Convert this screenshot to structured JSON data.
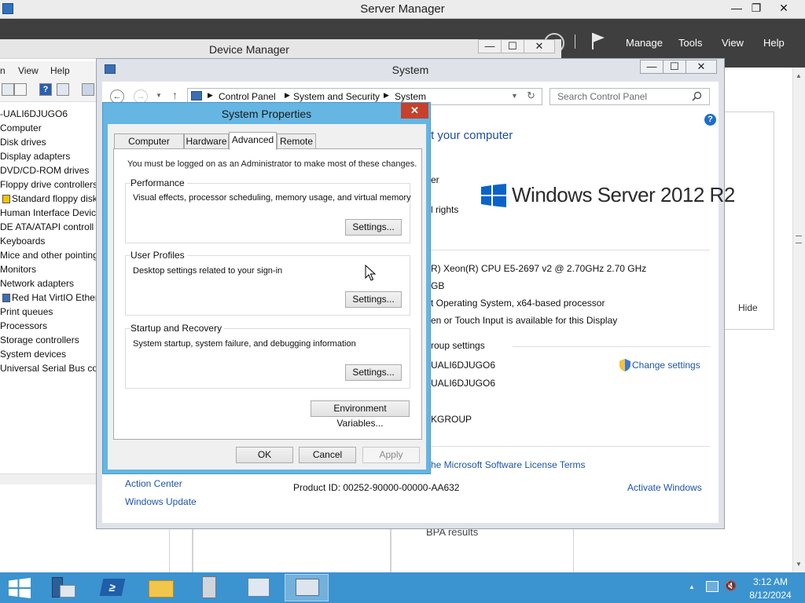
{
  "server_manager": {
    "title": "Server Manager",
    "menu": [
      "Manage",
      "Tools",
      "View",
      "Help"
    ],
    "controls": [
      "—",
      "❐",
      "✕"
    ],
    "hide_label": "Hide",
    "bpa_label": "BPA results"
  },
  "device_manager": {
    "title": "Device Manager",
    "controls": [
      "—",
      "☐",
      "✕"
    ],
    "menu": [
      "n",
      "View",
      "Help"
    ],
    "tree": [
      "-UALI6DJUGO6",
      "Computer",
      "Disk drives",
      "Display adapters",
      "DVD/CD-ROM drives",
      "Floppy drive controllers",
      "Standard floppy disk",
      "Human Interface Device",
      "DE ATA/ATAPI controll",
      "Keyboards",
      "Mice and other pointing",
      "Monitors",
      "Network adapters",
      "Red Hat VirtIO Ethern",
      "Print queues",
      "Processors",
      "Storage controllers",
      "System devices",
      "Universal Serial Bus cont"
    ]
  },
  "system": {
    "title": "System",
    "controls": [
      "—",
      "☐",
      "✕"
    ],
    "breadcrumb": [
      "Control Panel",
      "System and Security",
      "System"
    ],
    "search_placeholder": "Search Control Panel",
    "heading_fragment": "t your computer",
    "edition_frag": "er",
    "rights_frag": "l rights",
    "logo_text": "Windows Server 2012 R2",
    "processor": "R) Xeon(R) CPU E5-2697 v2 @ 2.70GHz   2.70 GHz",
    "memory": "GB",
    "system_type": "t Operating System, x64-based processor",
    "pen_touch": "en or Touch Input is available for this Display",
    "group_heading": "roup settings",
    "computer_name": "UALI6DJUGO6",
    "full_name": "UALI6DJUGO6",
    "workgroup": "KGROUP",
    "change_settings": "Change settings",
    "license_link": "he Microsoft Software License Terms",
    "product_id": "Product ID:  00252-90000-00000-AA632",
    "activate": "Activate Windows",
    "see_also": [
      "Action Center",
      "Windows Update"
    ]
  },
  "system_properties": {
    "title": "System Properties",
    "close": "✕",
    "tabs": [
      "Computer Name",
      "Hardware",
      "Advanced",
      "Remote"
    ],
    "active_tab": "Advanced",
    "admin_note": "You must be logged on as an Administrator to make most of these changes.",
    "performance": {
      "title": "Performance",
      "desc": "Visual effects, processor scheduling, memory usage, and virtual memory",
      "button": "Settings..."
    },
    "user_profiles": {
      "title": "User Profiles",
      "desc": "Desktop settings related to your sign-in",
      "button": "Settings..."
    },
    "startup_recovery": {
      "title": "Startup and Recovery",
      "desc": "System startup, system failure, and debugging information",
      "button": "Settings..."
    },
    "env_button": "Environment Variables...",
    "ok": "OK",
    "cancel": "Cancel",
    "apply": "Apply"
  },
  "taskbar": {
    "time": "3:12 AM",
    "date": "8/12/2024",
    "apps": [
      "start",
      "server-manager",
      "powershell",
      "file-explorer",
      "device-manager-app",
      "control-panel-app",
      "remote-desktop-app"
    ],
    "accent": "#3b93cf"
  }
}
